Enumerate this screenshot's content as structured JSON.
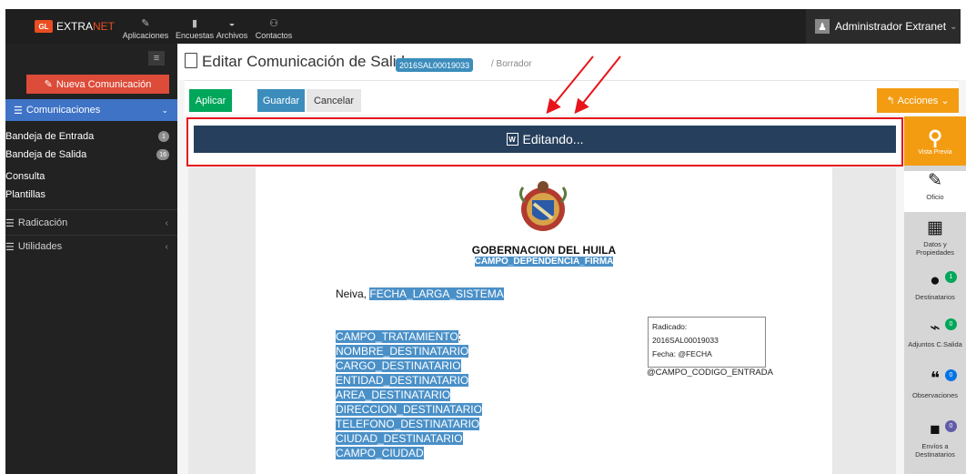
{
  "app": {
    "brand_part1": "EXTRA",
    "brand_part2": "NET",
    "brand_badge": "GL"
  },
  "topnav": [
    {
      "label": "Aplicaciones",
      "icon": "pencil-icon"
    },
    {
      "label": "Encuestas",
      "icon": "document-icon"
    },
    {
      "label": "Archivos",
      "icon": "inbox-icon"
    },
    {
      "label": "Contactos",
      "icon": "users-icon"
    }
  ],
  "user": {
    "name": "Administrador Extranet",
    "icon": "user-icon"
  },
  "sidebar": {
    "new_button": "Nueva Comunicación",
    "active_section": "Comunicaciones",
    "sub_items": [
      {
        "label": "Bandeja de Entrada",
        "badge": "1"
      },
      {
        "label": "Bandeja de Salida",
        "badge": "16"
      },
      {
        "label": "Consulta",
        "badge": ""
      },
      {
        "label": "Plantillas",
        "badge": ""
      }
    ],
    "groups": [
      {
        "label": "Radicación"
      },
      {
        "label": "Utilidades"
      }
    ]
  },
  "page": {
    "title": "Editar Comunicación de Salida",
    "code_badge": "2016SAL00019033",
    "status": "/ Borrador"
  },
  "toolbar": {
    "aplicar": "Aplicar",
    "guardar": "Guardar",
    "cancelar": "Cancelar",
    "acciones": "Acciones"
  },
  "editor": {
    "status": "Editando...",
    "word_icon": "W"
  },
  "document": {
    "org": "GOBERNACION DEL HUILA",
    "dependencia": "CAMPO_DEPENDENCIA_FIRMA",
    "city": "Neiva,",
    "date_field": "FECHA_LARGA_SISTEMA",
    "fields": [
      "CAMPO_TRATAMIENTO",
      "NOMBRE_DESTINATARIO",
      "CARGO_DESTINATARIO",
      "ENTIDAD_DESTINATARIO",
      "AREA_DESTINATARIO",
      "DIRECCION_DESTINATARIO",
      "TELEFONO_DESTINATARIO",
      "CIUDAD_DESTINATARIO",
      "CAMPO_CIUDAD"
    ],
    "colon": ":",
    "radicado_label": "Radicado:",
    "radicado_value": "2016SAL00019033",
    "fecha_label": "Fecha: @FECHA",
    "codigo": "@CAMPO_CODIGO_ENTRADA"
  },
  "right_panel": {
    "vista_previa": "Vista Previa",
    "items": [
      {
        "label": "Oficio",
        "badge": "",
        "icon": "edit-icon"
      },
      {
        "label": "Datos y Propiedades",
        "badge": "",
        "icon": "grid-icon"
      },
      {
        "label": "Destinatarios",
        "badge": "1",
        "badge_color": "#00a65a",
        "icon": "user-icon"
      },
      {
        "label": "Adjuntos C.Salida",
        "badge": "0",
        "badge_color": "#00a65a",
        "icon": "paperclip-icon"
      },
      {
        "label": "Observaciones",
        "badge": "0",
        "badge_color": "#0073e6",
        "icon": "comments-icon"
      },
      {
        "label": "Envíos a Destinatarios",
        "badge": "0",
        "badge_color": "#605ca8",
        "icon": "truck-icon"
      }
    ]
  },
  "colors": {
    "accent_red": "#dd4b39",
    "primary": "#3c8dbc",
    "success": "#00a65a",
    "warning": "#f39c12",
    "editor_bar": "#263f5d"
  }
}
